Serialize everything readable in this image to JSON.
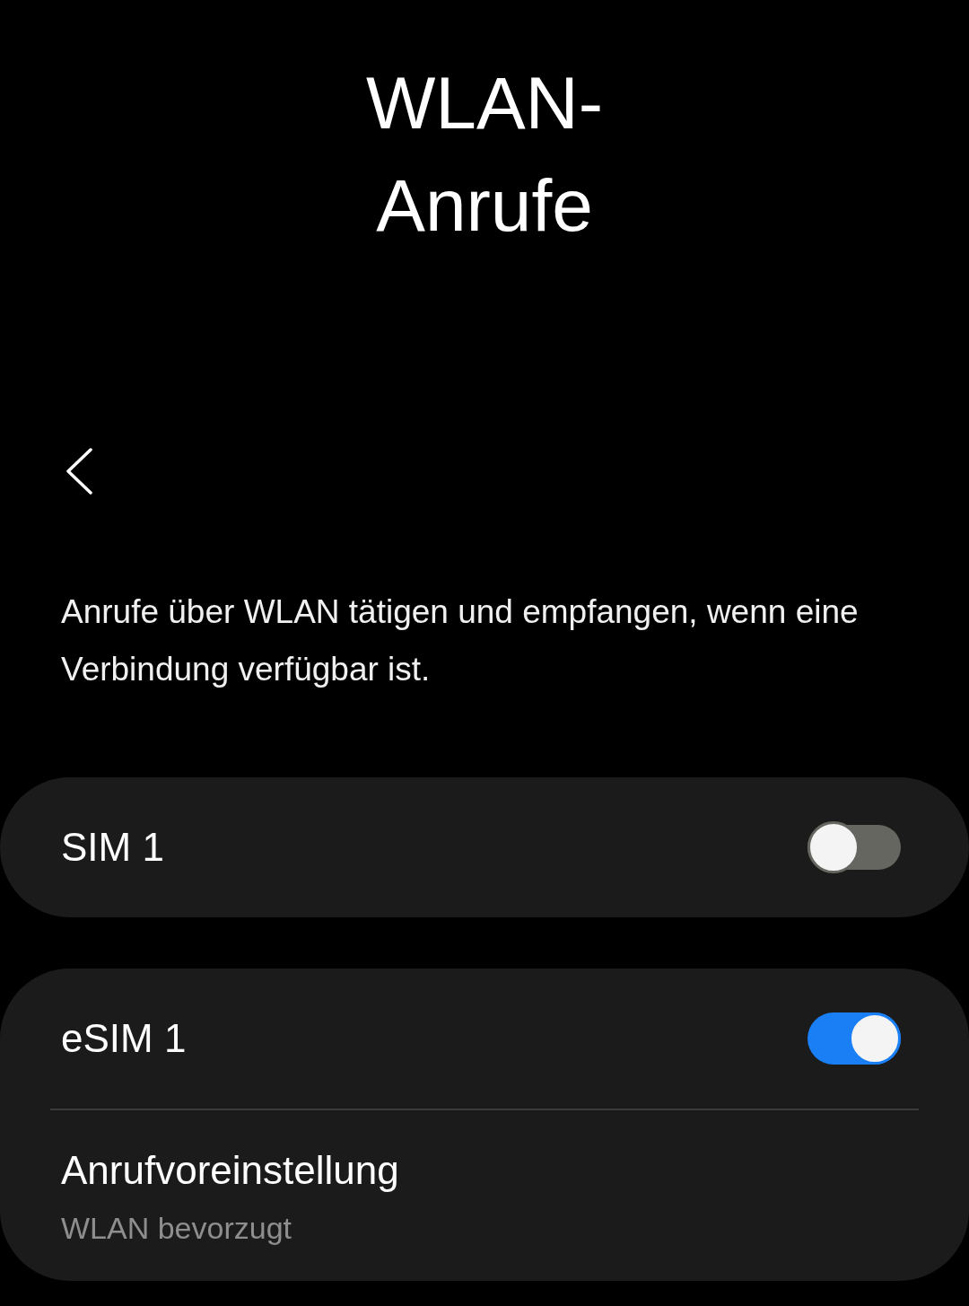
{
  "title": "WLAN-Anrufe",
  "description": "Anrufe über WLAN tätigen und empfangen, wenn eine Verbindung verfügbar ist.",
  "groups": [
    {
      "items": [
        {
          "kind": "toggle",
          "label": "SIM 1",
          "on": false
        }
      ]
    },
    {
      "items": [
        {
          "kind": "toggle",
          "label": "eSIM 1",
          "on": true
        },
        {
          "kind": "option",
          "label": "Anrufvoreinstellung",
          "value": "WLAN bevorzugt"
        }
      ]
    }
  ]
}
